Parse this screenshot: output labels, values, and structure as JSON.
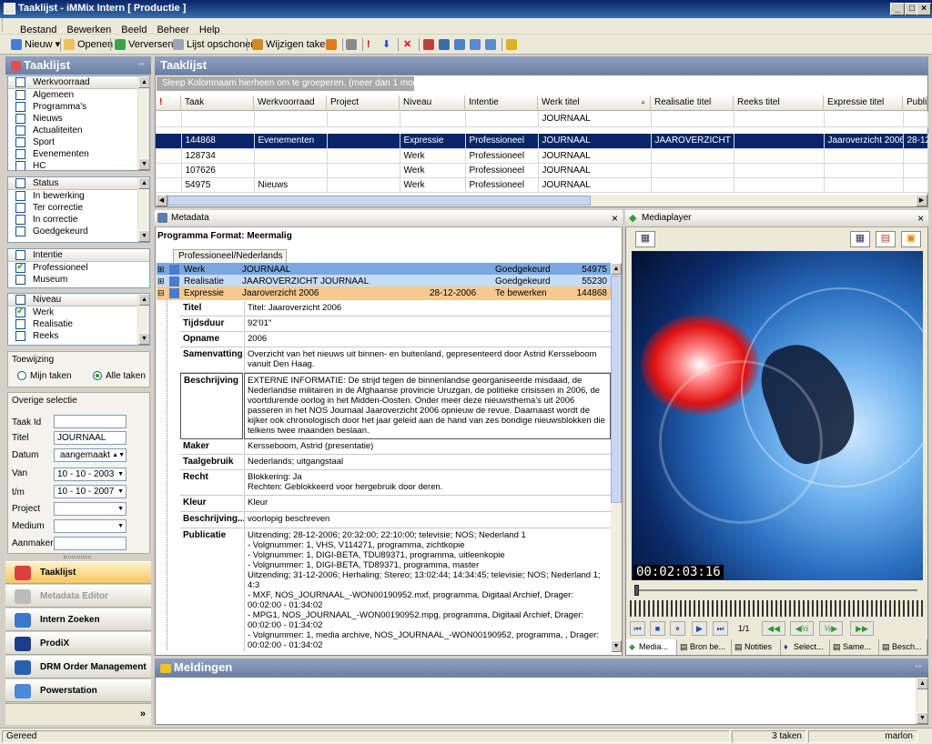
{
  "window": {
    "title": "Taaklijst - iMMix Intern [ Productie ]"
  },
  "menu": [
    "Bestand",
    "Bewerken",
    "Beeld",
    "Beheer",
    "Help"
  ],
  "toolbar": {
    "nieuw": "Nieuw",
    "openen": "Openen",
    "verversen": "Verversen",
    "lijst_opschonen": "Lijst opschonen",
    "wijzigen_taken": "Wijzigen taken"
  },
  "left": {
    "title": "Taaklijst",
    "werkvoorraad": {
      "header": "Werkvoorraad",
      "items": [
        "Algemeen",
        "Programma's",
        "Nieuws",
        "Actualiteiten",
        "Sport",
        "Evenementen",
        "HC"
      ]
    },
    "status": {
      "header": "Status",
      "items": [
        "In bewerking",
        "Ter correctie",
        "In correctie",
        "Goedgekeurd"
      ]
    },
    "intentie": {
      "header": "Intentie",
      "items": [
        "Professioneel",
        "Museum"
      ]
    },
    "niveau": {
      "header": "Niveau",
      "items": [
        "Werk",
        "Realisatie",
        "Reeks"
      ]
    },
    "toewijzing": {
      "title": "Toewijzing",
      "mijn": "Mijn taken",
      "alle": "Alle taken"
    },
    "overige": {
      "title": "Overige selectie",
      "taak_id_label": "Taak Id",
      "titel_label": "Titel",
      "titel_value": "JOURNAAL",
      "datum_label": "Datum",
      "datum_value": "aangemaakt",
      "van_label": "Van",
      "van_value": "10 - 10 - 2003",
      "tm_label": "t/m",
      "tm_value": "10 - 10 - 2007",
      "project_label": "Project",
      "medium_label": "Medium",
      "aanmaker_label": "Aanmaker"
    },
    "nav": [
      "Taaklijst",
      "Metadata Editor",
      "Intern Zoeken",
      "ProdiX",
      "DRM Order Management",
      "Powerstation"
    ],
    "more": "»"
  },
  "tasks": {
    "title": "Taaklijst",
    "group_hint": "Sleep Kolomnaam hierheen om te groeperen. (meer dan 1 mogelijk)",
    "columns": [
      "!",
      "Taak",
      "Werkvoorraad",
      "Project",
      "Niveau",
      "Intentie",
      "Werk titel",
      "Realisatie titel",
      "Reeks titel",
      "Expressie titel",
      "Publi"
    ],
    "filter": [
      "",
      "",
      "",
      "",
      "",
      "",
      "JOURNAAL",
      "",
      "",
      "",
      ""
    ],
    "rows": [
      [
        "",
        "144868",
        "Evenementen",
        "",
        "Expressie",
        "Professioneel",
        "JOURNAAL",
        "JAAROVERZICHT ...",
        "",
        "Jaaroverzicht 2006",
        "28-12"
      ],
      [
        "",
        "128734",
        "",
        "",
        "Werk",
        "Professioneel",
        "JOURNAAL",
        "",
        "",
        "",
        ""
      ],
      [
        "",
        "107626",
        "",
        "",
        "Werk",
        "Professioneel",
        "JOURNAAL",
        "",
        "",
        "",
        ""
      ],
      [
        "",
        "54975",
        "Nieuws",
        "",
        "Werk",
        "Professioneel",
        "JOURNAAL",
        "",
        "",
        "",
        ""
      ]
    ]
  },
  "metadata": {
    "title": "Metadata",
    "format": "Programma Format: Meermalig",
    "tab": "Professioneel/Nederlands",
    "tree": [
      {
        "level": "Werk",
        "name": "JOURNAAL",
        "date": "",
        "status": "Goedgekeurd",
        "id": "54975"
      },
      {
        "level": "Realisatie",
        "name": "JAAROVERZICHT JOURNAAL",
        "date": "",
        "status": "Goedgekeurd",
        "id": "55230"
      },
      {
        "level": "Expressie",
        "name": "Jaaroverzicht 2006",
        "date": "28-12-2006",
        "status": "Te bewerken",
        "id": "144868"
      }
    ],
    "fields": [
      {
        "label": "Titel",
        "value": "Titel: Jaaroverzicht 2006"
      },
      {
        "label": "Tijdsduur",
        "value": "92'01\""
      },
      {
        "label": "Opname",
        "value": "2006"
      },
      {
        "label": "Samenvatting",
        "value": "Overzicht van het nieuws uit binnen- en buitenland, gepresenteerd door Astrid Kersseboom vanuit Den Haag."
      },
      {
        "label": "Beschrijving",
        "value": "EXTERNE INFORMATIE: De strijd tegen de binnenlandse georganiseerde misdaad, de Nederlandse militairen in de Afghaanse provincie Uruzgan, de politieke crisissen in 2006, de voortdurende oorlog in het Midden-Oosten. Onder meer deze nieuwsthema's uit 2006 passeren in het NOS Journaal Jaaroverzicht 2006 opnieuw de revue. Daarnaast wordt de kijker ook chronologisch door het jaar geleid aan de hand van zes bondige nieuwsblokken die telkens twee maanden beslaan."
      },
      {
        "label": "Maker",
        "value": "Kersseboom, Astrid (presentatie)"
      },
      {
        "label": "Taalgebruik",
        "value": "Nederlands; uitgangstaal"
      },
      {
        "label": "Recht",
        "value": "Blokkering: Ja\nRechten: Geblokkeerd voor hergebruik door deren."
      },
      {
        "label": "Kleur",
        "value": "Kleur"
      },
      {
        "label": "Beschrijving...",
        "value": "voorlopig beschreven"
      },
      {
        "label": "Publicatie",
        "value": "Uitzending; 28-12-2006; 20:32:00; 22:10:00; televisie; NOS; Nederland 1\n   - Volgnummer: 1, VHS, V114271, programma, zichtkopie\n   - Volgnummer: 1, DIGI-BETA, TDU89371, programma, uitleenkopie\n   - Volgnummer: 1, DIGI-BETA, TD89371, programma, master\nUitzending; 31-12-2006; Herhaling; Stereo; 13:02:44; 14:34:45; televisie; NOS; Nederland 1; 4:3\n   - MXF, NOS_JOURNAAL_-WON00190952.mxf, programma, Digitaal Archief,  Drager: 00:02:00 - 01:34:02\n   - MPG1, NOS_JOURNAAL_-WON00190952.mpg, programma, Digitaal Archief, Drager: 00:02:00 - 01:34:02\n   - Volgnummer: 1, media archive, NOS_JOURNAAL_-WON00190952, programma, , Drager: 00:02:00 - 01:34:02"
      }
    ]
  },
  "mediaplayer": {
    "title": "Mediaplayer",
    "timecode": "00:02:03:16",
    "frame_counter": "1/1",
    "tabs": [
      "Media...",
      "Bron be...",
      "Notities",
      "Select...",
      "Same...",
      "Besch..."
    ]
  },
  "meldingen": {
    "title": "Meldingen"
  },
  "status": {
    "left": "Gereed",
    "taken": "3 taken",
    "user": "marlon"
  }
}
